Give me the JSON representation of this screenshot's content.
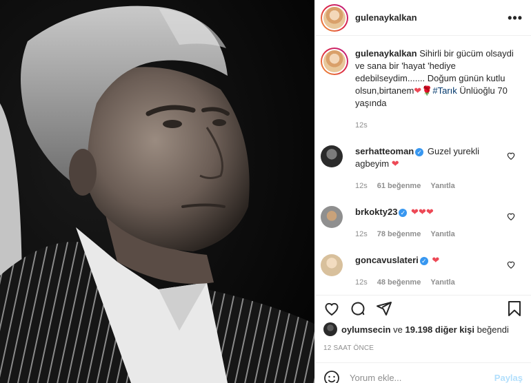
{
  "post": {
    "author": "gulenaykalkan",
    "more_icon": "more-icon",
    "caption": {
      "username": "gulenaykalkan",
      "text_part1": "Sihirli bir gücüm olsaydi ve sana bir 'hayat 'hediye edebilseydim....... Doğum günün kutlu olsun,birtanem",
      "hashtag": "#Tarık",
      "text_part2": "Ünlüoğlu 70 yaşında",
      "time": "12s"
    },
    "comments": [
      {
        "username": "serhatteoman",
        "text": "Guzel yurekli agbeyim",
        "hearts": "❤",
        "time": "12s",
        "likes": "61 beğenme",
        "reply": "Yanıtla"
      },
      {
        "username": "brkokty23",
        "text": "",
        "hearts": "❤❤❤",
        "time": "12s",
        "likes": "78 beğenme",
        "reply": "Yanıtla"
      },
      {
        "username": "goncavuslateri",
        "text": "",
        "hearts": "❤",
        "time": "12s",
        "likes": "48 beğenme",
        "reply": "Yanıtla"
      }
    ],
    "liked_by": {
      "user": "oylumsecin",
      "connector": "ve",
      "others": "19.198 diğer kişi",
      "suffix": "beğendi"
    },
    "timestamp": "12 SAAT ÖNCE",
    "add_comment": {
      "placeholder": "Yorum ekle...",
      "share_label": "Paylaş"
    },
    "colors": {
      "heart": "#ed4956",
      "verified": "#3897f0",
      "link": "#00376b",
      "share": "#b2dffc"
    }
  }
}
